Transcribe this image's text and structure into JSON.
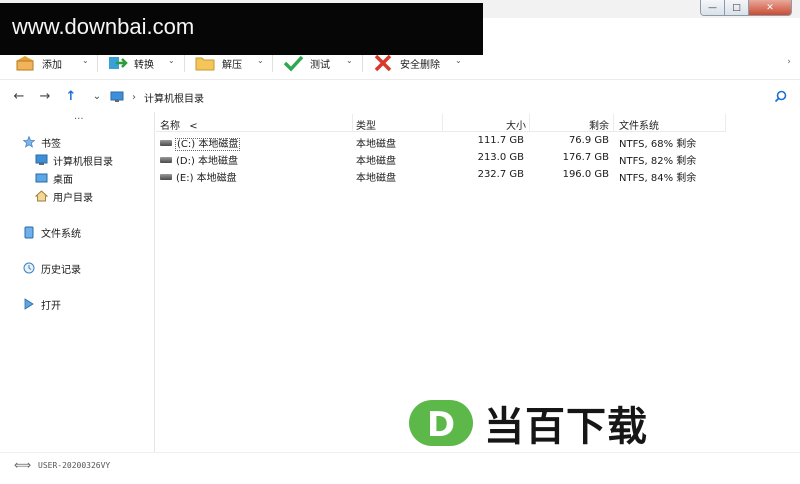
{
  "watermark": {
    "site": "www.downbai.com",
    "brand": "当百下载",
    "logo_letter": "D"
  },
  "window_controls": {
    "minimize": "—",
    "maximize": "□",
    "close": "✕"
  },
  "toolbar": {
    "add_label": "添加",
    "convert_label": "转换",
    "extract_label": "解压",
    "test_label": "测试",
    "secure_delete_label": "安全删除"
  },
  "address": {
    "path": "计算机根目录"
  },
  "sidebar": {
    "dots": "···",
    "bookmarks": "书签",
    "computer_root": "计算机根目录",
    "desktop": "桌面",
    "user_dir": "用户目录",
    "file_system": "文件系统",
    "history": "历史记录",
    "open": "打开"
  },
  "columns": {
    "name": "名称",
    "sort_indicator": "<",
    "type": "类型",
    "size": "大小",
    "free": "剩余",
    "fs": "文件系统"
  },
  "rows": [
    {
      "name": "(C:) 本地磁盘",
      "type": "本地磁盘",
      "size": "111.7 GB",
      "free": "76.9 GB",
      "fs": "NTFS, 68% 剩余"
    },
    {
      "name": "(D:) 本地磁盘",
      "type": "本地磁盘",
      "size": "213.0 GB",
      "free": "176.7 GB",
      "fs": "NTFS, 82% 剩余"
    },
    {
      "name": "(E:) 本地磁盘",
      "type": "本地磁盘",
      "size": "232.7 GB",
      "free": "196.0 GB",
      "fs": "NTFS, 84% 剩余"
    }
  ],
  "status": {
    "computer_name": "USER-20200326VY"
  },
  "colors": {
    "accent": "#1d6fd3",
    "brand_green": "#5db84a",
    "close_red": "#c7452b"
  }
}
